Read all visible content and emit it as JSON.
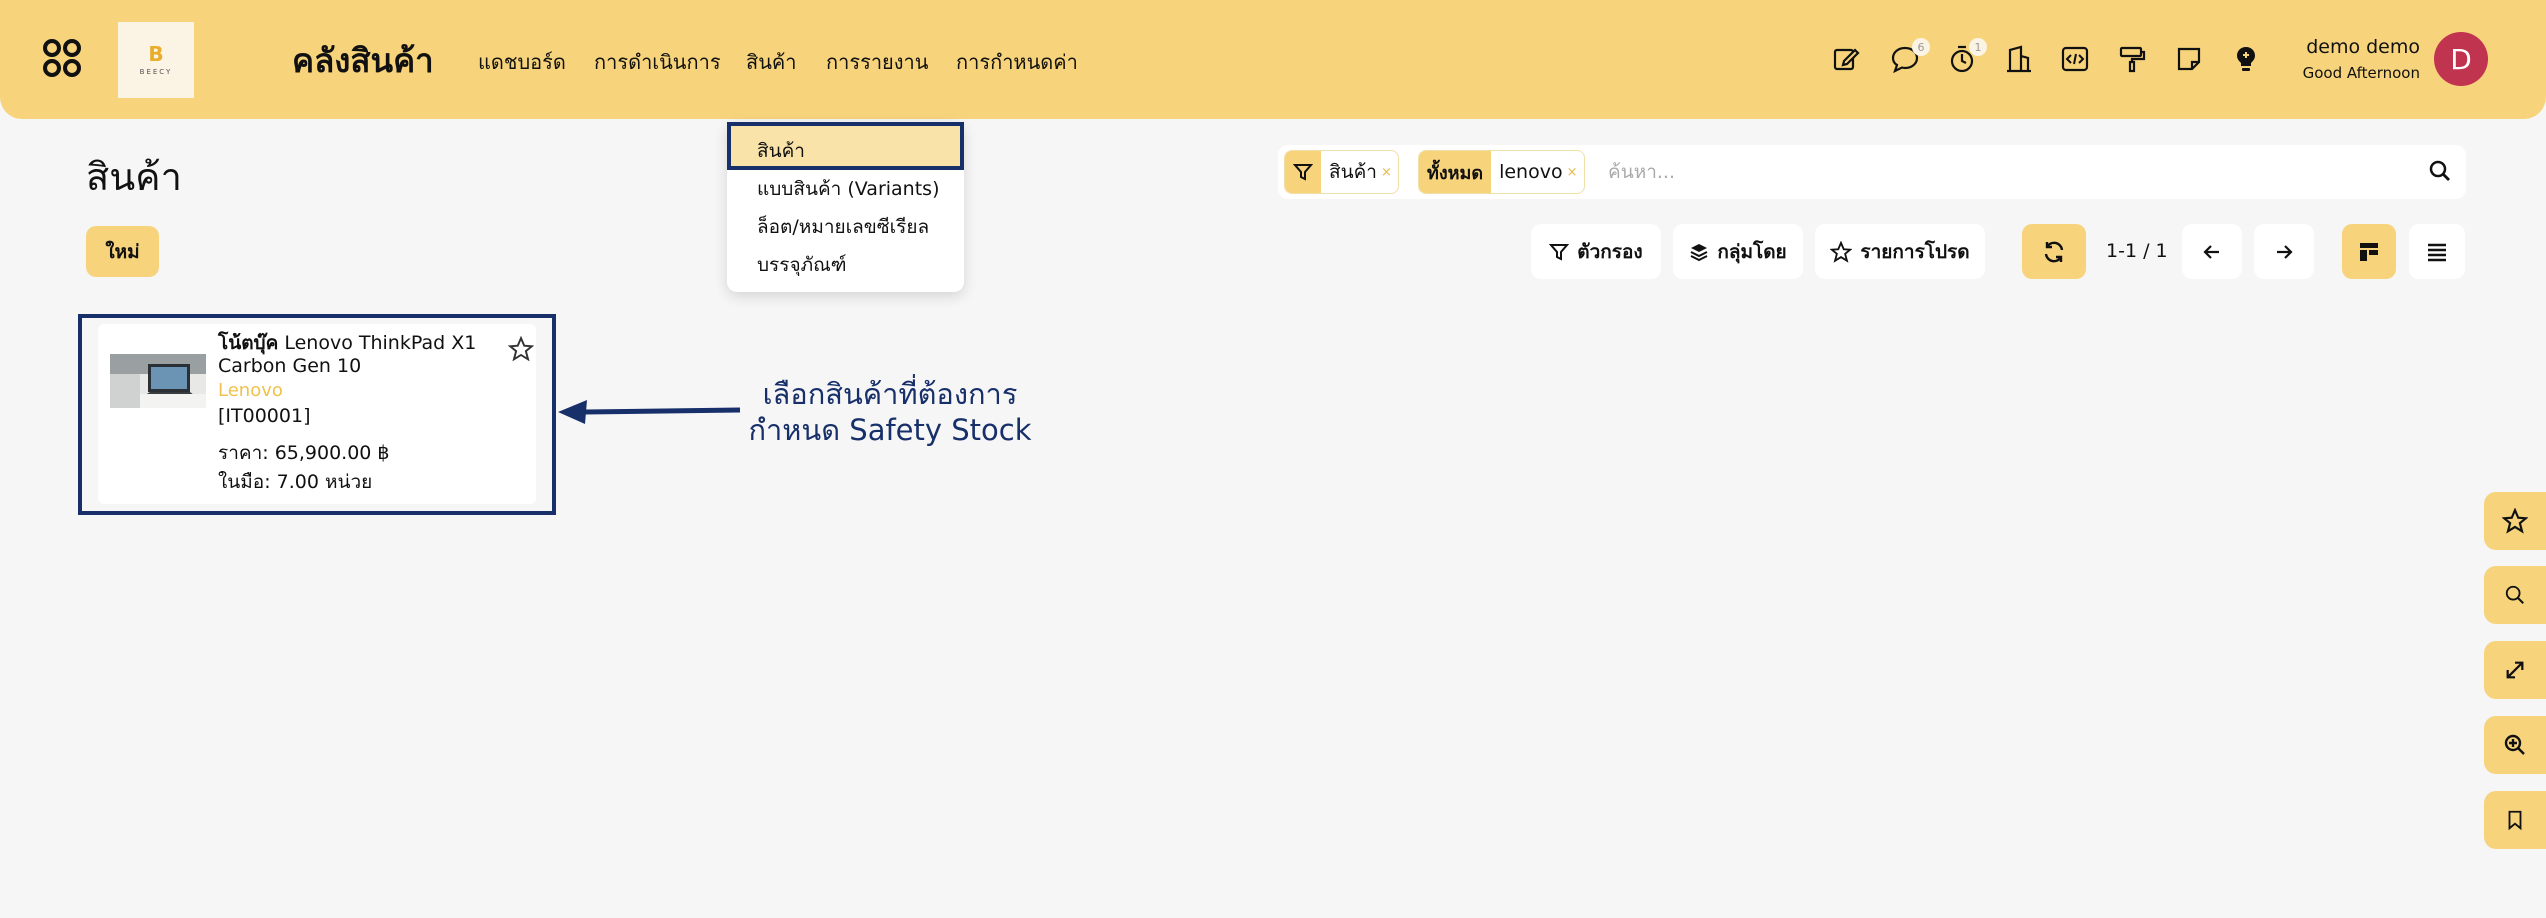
{
  "app": {
    "title": "คลังสินค้า",
    "logo_text": "BEECY",
    "logo_letter": "B",
    "accent_color": "#f7d47c",
    "frame_color": "#17306a"
  },
  "nav": {
    "items": [
      "แดชบอร์ด",
      "การดำเนินการ",
      "สินค้า",
      "การรายงาน",
      "การกำหนดค่า"
    ]
  },
  "toolbar": {
    "icons": [
      "edit-icon",
      "chat-icon",
      "timer-icon",
      "building-icon",
      "code-icon",
      "paint-roller-icon",
      "sticky-note-icon",
      "lightbulb-icon"
    ],
    "chat_badge": "6",
    "timer_badge": "1"
  },
  "user": {
    "name": "demo demo",
    "greeting": "Good Afternoon",
    "initial": "D"
  },
  "dropdown": {
    "items": [
      "สินค้า",
      "แบบสินค้า (Variants)",
      "ล็อต/หมายเลขซีเรียล",
      "บรรจุภัณฑ์"
    ]
  },
  "page": {
    "title": "สินค้า",
    "new_button": "ใหม่"
  },
  "search": {
    "facet1_value": "สินค้า",
    "facet2_head": "ทั้งหมด",
    "facet2_value": "lenovo",
    "remove_glyph": "×",
    "placeholder": "ค้นหา..."
  },
  "controls": {
    "filters": "ตัวกรอง",
    "group_by": "กลุ่มโดย",
    "favorites": "รายการโปรด",
    "pager": "1-1 / 1"
  },
  "product": {
    "name_bold": "โน้ตบุ๊ค",
    "name_rest": "Lenovo ThinkPad X1 Carbon Gen 10",
    "brand": "Lenovo",
    "code": "[IT00001]",
    "price": "ราคา: 65,900.00 ฿",
    "on_hand": "ในมือ: 7.00 หน่วย"
  },
  "annotation": {
    "line1": "เลือกสินค้าที่ต้องการ",
    "line2": "กำหนด Safety Stock"
  },
  "floating_tools": [
    "star-icon",
    "search-icon",
    "expand-icon",
    "zoom-in-icon",
    "bookmark-icon"
  ]
}
